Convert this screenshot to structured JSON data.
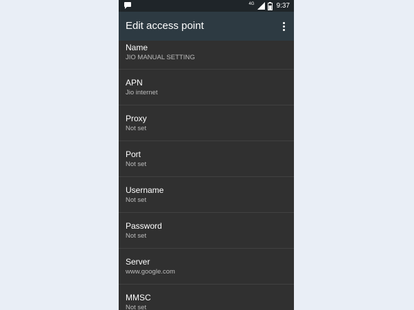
{
  "status_bar": {
    "network_label": "4G",
    "time": "9:37"
  },
  "app_bar": {
    "title": "Edit access point"
  },
  "settings": [
    {
      "title": "Name",
      "value": "JIO MANUAL SETTING"
    },
    {
      "title": "APN",
      "value": "Jio internet"
    },
    {
      "title": "Proxy",
      "value": "Not set"
    },
    {
      "title": "Port",
      "value": "Not set"
    },
    {
      "title": "Username",
      "value": "Not set"
    },
    {
      "title": "Password",
      "value": "Not set"
    },
    {
      "title": "Server",
      "value": "www.google.com"
    },
    {
      "title": "MMSC",
      "value": "Not set"
    }
  ],
  "colors": {
    "page_background": "#e9eef6",
    "app_bar": "#2d3a42",
    "list_background": "#303030",
    "divider": "#414141"
  },
  "icons": [
    "notification-icon",
    "network-type-icon",
    "signal-icon",
    "battery-icon",
    "more-options-icon"
  ]
}
